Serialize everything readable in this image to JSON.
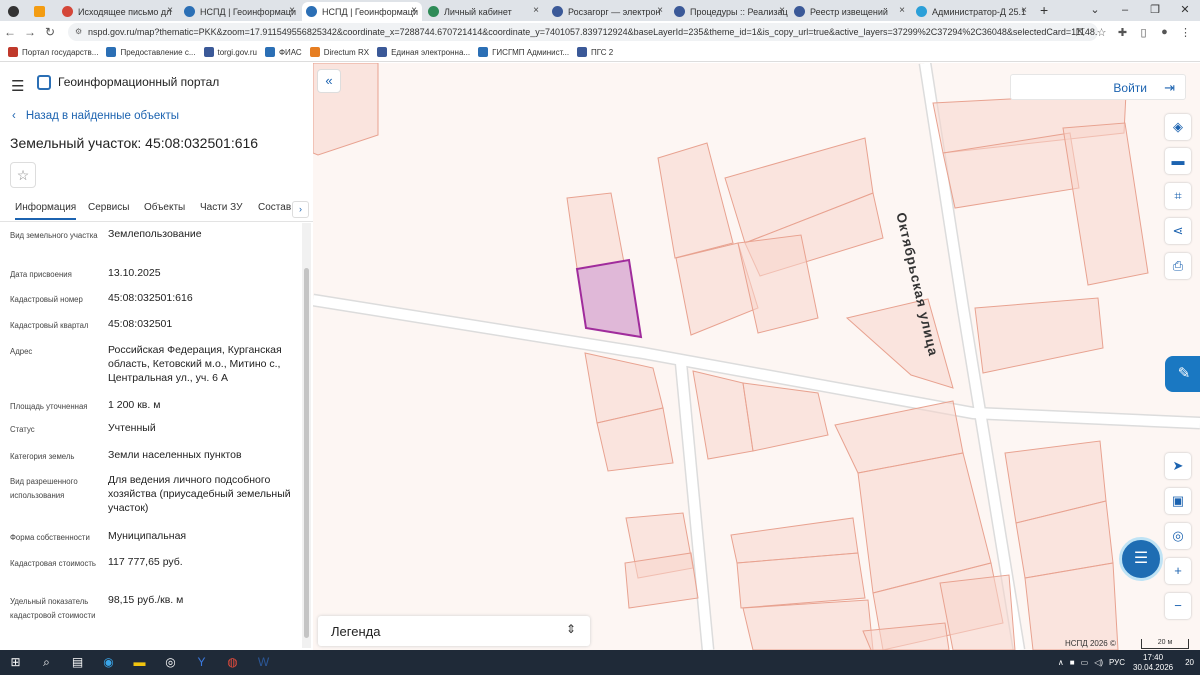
{
  "browser": {
    "tabs": [
      {
        "label": "Исходящее письмо дл",
        "color": "#d44638",
        "active": false
      },
      {
        "label": "НСПД | Геоинформаци",
        "color": "#2b6fb5",
        "active": false
      },
      {
        "label": "НСПД | Геоинформаци",
        "color": "#2b6fb5",
        "active": true
      },
      {
        "label": "Личный кабинет",
        "color": "#2e8b57",
        "active": false
      },
      {
        "label": "Росзагорг — электрон",
        "color": "#3b5998",
        "active": false
      },
      {
        "label": "Процедуры :: Реализац",
        "color": "#3b5998",
        "active": false
      },
      {
        "label": "Реестр извещений",
        "color": "#3b5998",
        "active": false
      },
      {
        "label": "Администратор-Д 25.1",
        "color": "#2b9fd8",
        "active": false
      }
    ],
    "new_tab": "+",
    "url": "nspd.gov.ru/map?thematic=PKK&zoom=17.911549556825342&coordinate_x=7288744.670721414&coordinate_y=7401057.839712924&baseLayerId=235&theme_id=1&is_copy_url=true&active_layers=37299%2C37294%2C36048&selectedCard=11148...",
    "bookmarks": [
      {
        "label": "Портал государств...",
        "color": "#c0392b"
      },
      {
        "label": "Предоставление с...",
        "color": "#2b6fb5"
      },
      {
        "label": "torgi.gov.ru",
        "color": "#3b5998"
      },
      {
        "label": "ФИАС",
        "color": "#2b6fb5"
      },
      {
        "label": "Directum RX",
        "color": "#e67e22"
      },
      {
        "label": "Единая электронна...",
        "color": "#3b5998"
      },
      {
        "label": "ГИСГМП Админист...",
        "color": "#2b6fb5"
      },
      {
        "label": "ПГС 2",
        "color": "#3b5998"
      }
    ]
  },
  "app": {
    "title": "Геоинформационный портал",
    "back_link": "Назад в найденные объекты",
    "parcel_title": "Земельный участок: 45:08:032501:616",
    "tabs": [
      "Информация",
      "Сервисы",
      "Объекты",
      "Части ЗУ",
      "Состав"
    ],
    "properties": [
      {
        "key": "Вид земельного участка",
        "value": "Землепользование"
      },
      {
        "key": "Дата присвоения",
        "value": "13.10.2025"
      },
      {
        "key": "Кадастровый номер",
        "value": "45:08:032501:616"
      },
      {
        "key": "Кадастровый квартал",
        "value": "45:08:032501"
      },
      {
        "key": "Адрес",
        "value": "Российская Федерация, Курганская область, Кетовский м.о., Митино с., Центральная ул., уч. 6 А"
      },
      {
        "key": "Площадь уточненная",
        "value": "1 200 кв. м"
      },
      {
        "key": "Статус",
        "value": "Учтенный"
      },
      {
        "key": "Категория земель",
        "value": "Земли населенных пунктов"
      },
      {
        "key": "Вид разрешенного использования",
        "value": "Для ведения личного подсобного хозяйства (приусадебный земельный участок)"
      },
      {
        "key": "Форма собственности",
        "value": "Муниципальная"
      },
      {
        "key": "Кадастровая стоимость",
        "value": "117 777,65 руб."
      },
      {
        "key": "Удельный показатель кадастровой стоимости",
        "value": "98,15 руб./кв. м"
      }
    ]
  },
  "map": {
    "login": "Войти",
    "street": "Октябрьская улица",
    "legend": "Легенда",
    "copyright": "НСПД 2026 ©",
    "scale": "20 м",
    "parcel_stroke": "#e8a290",
    "parcel_fill": "#f7d6cc",
    "selected_fill": "#e0b8d8",
    "selected_stroke": "#a02c9c"
  },
  "taskbar": {
    "lang": "РУС",
    "time": "17:40",
    "date": "30.04.2026",
    "notifications": "20"
  }
}
